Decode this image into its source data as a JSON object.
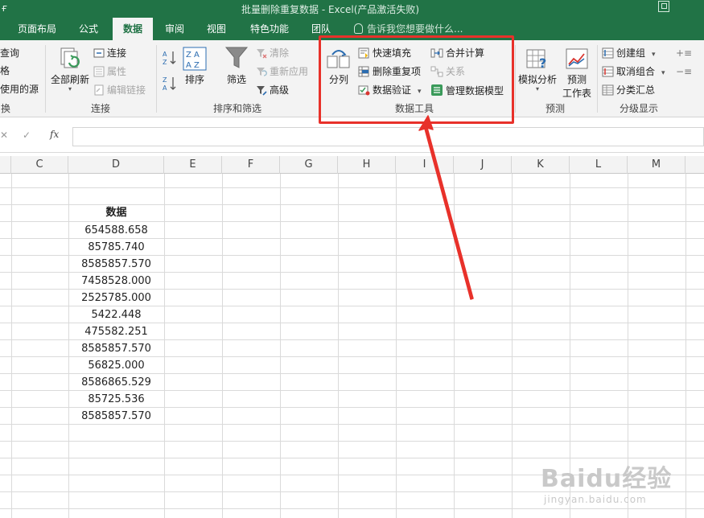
{
  "window": {
    "title": "批量删除重复数据 - Excel(产品激活失败)",
    "left_glyph": "ғ"
  },
  "tabs": [
    "页面布局",
    "公式",
    "数据",
    "审阅",
    "视图",
    "特色功能",
    "团队"
  ],
  "active_tab": "数据",
  "tell_me": "告诉我您想要做什么...",
  "ribbon": {
    "get_transform": {
      "items": [
        "查询",
        "格",
        "使用的源"
      ],
      "label": "换"
    },
    "connections": {
      "refresh_all": "全部刷新",
      "connections": "连接",
      "properties": "属性",
      "edit_links": "编辑链接",
      "label": "连接"
    },
    "sort_filter": {
      "sort": "排序",
      "filter": "筛选",
      "clear": "清除",
      "reapply": "重新应用",
      "advanced": "高级",
      "label": "排序和筛选"
    },
    "data_tools": {
      "text_to_columns": "分列",
      "flash_fill": "快速填充",
      "remove_duplicates": "删除重复项",
      "data_validation": "数据验证",
      "consolidate": "合并计算",
      "relationships": "关系",
      "manage_data_model": "管理数据模型",
      "label": "数据工具"
    },
    "forecast": {
      "what_if": "模拟分析",
      "forecast_sheet_1": "预测",
      "forecast_sheet_2": "工作表",
      "label": "预测"
    },
    "outline": {
      "group": "创建组",
      "ungroup": "取消组合",
      "subtotal": "分类汇总",
      "label": "分级显示"
    }
  },
  "formula_bar": {
    "cancel": "✕",
    "enter": "✓",
    "fx": "fx",
    "value": ""
  },
  "columns": [
    "C",
    "D",
    "E",
    "F",
    "G",
    "H",
    "I",
    "J",
    "K",
    "L",
    "M"
  ],
  "sheet": {
    "header": "数据",
    "values": [
      "654588.658",
      "85785.740",
      "8585857.570",
      "7458528.000",
      "2525785.000",
      "5422.448",
      "475582.251",
      "8585857.570",
      "56825.000",
      "8586865.529",
      "85725.536",
      "8585857.570"
    ]
  },
  "watermark": {
    "brand": "Baidu经验",
    "url": "jingyan.baidu.com"
  },
  "colors": {
    "excel_green": "#217346",
    "highlight_red": "#e8312a"
  }
}
